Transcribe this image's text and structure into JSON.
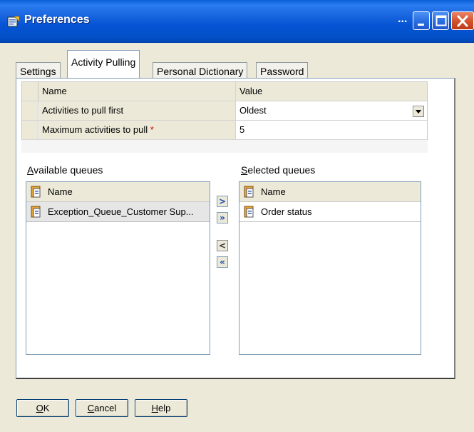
{
  "window": {
    "title": "Preferences",
    "ellipsis": "..."
  },
  "tabs": [
    {
      "label": "Settings",
      "active": false
    },
    {
      "label": "Activity Pulling",
      "active": true
    },
    {
      "label": "Personal Dictionary",
      "active": false
    },
    {
      "label": "Password",
      "active": false
    }
  ],
  "grid": {
    "headers": {
      "name": "Name",
      "value": "Value"
    },
    "rows": [
      {
        "name": "Activities to pull first",
        "value": "Oldest",
        "required": ""
      },
      {
        "name": "Maximum activities to pull",
        "value": "5",
        "required": "*"
      }
    ]
  },
  "available": {
    "label_accel": "A",
    "label_rest": "vailable queues",
    "header": "Name",
    "items": [
      "Exception_Queue_Customer Sup..."
    ]
  },
  "selected": {
    "label_accel": "S",
    "label_rest": "elected queues",
    "header": "Name",
    "items": [
      "Order status"
    ]
  },
  "move_buttons": {
    "add": ">",
    "add_all": "»",
    "remove": "<",
    "remove_all": "«"
  },
  "buttons": {
    "ok_accel": "O",
    "ok_rest": "K",
    "cancel_accel": "C",
    "cancel_rest": "ancel",
    "help_accel": "H",
    "help_rest": "elp"
  }
}
